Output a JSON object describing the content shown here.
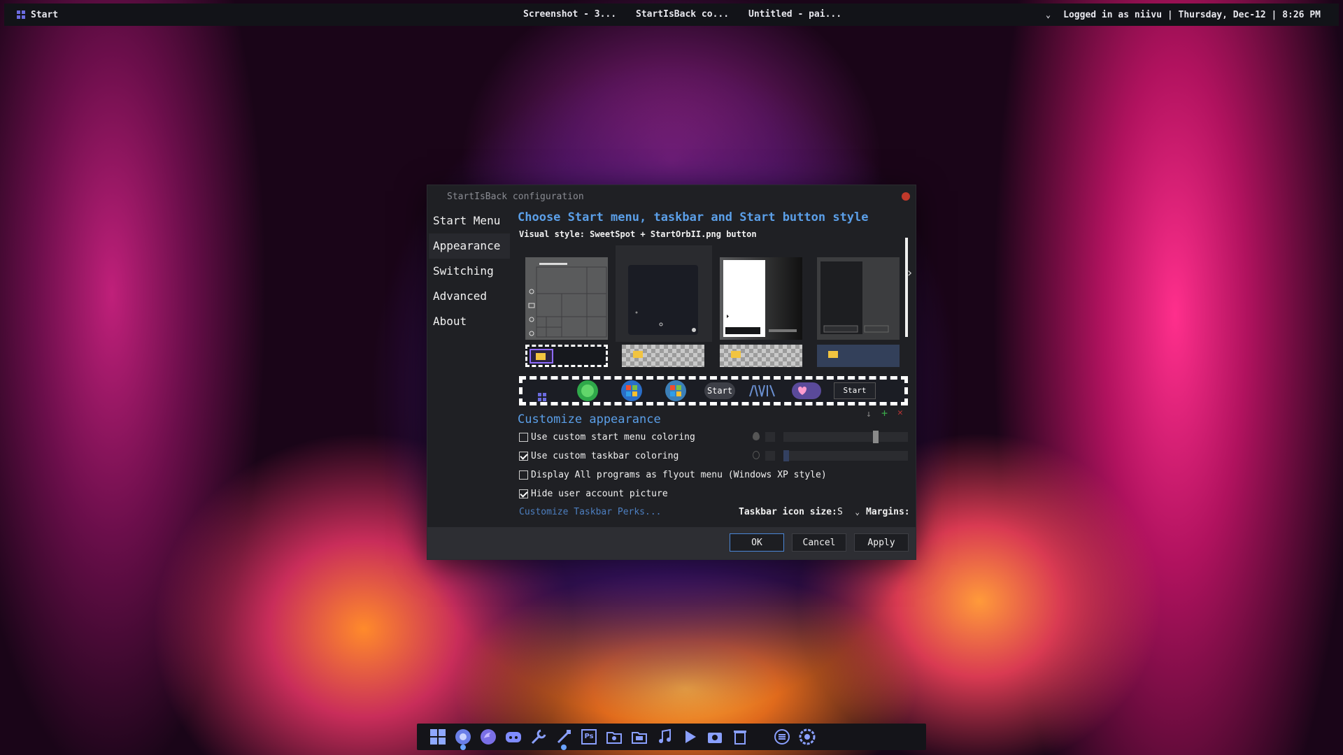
{
  "topbar": {
    "start_label": "Start",
    "tasks": [
      "Screenshot - 3...",
      "StartIsBack co...",
      "Untitled - pai..."
    ],
    "status": "Logged in as niivu | Thursday, Dec-12 | 8:26 PM"
  },
  "dialog": {
    "title": "StartIsBack configuration",
    "nav": [
      "Start Menu",
      "Appearance",
      "Switching",
      "Advanced",
      "About"
    ],
    "active_nav": "Appearance",
    "heading": "Choose Start menu, taskbar and Start button style",
    "visual_style": "Visual style: SweetSpot + StartOrbII.png button",
    "orbs": [
      "Start",
      "Start"
    ],
    "customize_heading": "Customize appearance",
    "options": [
      {
        "label": "Use custom start menu coloring",
        "checked": false
      },
      {
        "label": "Use custom taskbar coloring",
        "checked": true
      },
      {
        "label": "Display All programs as flyout menu (Windows XP style)",
        "checked": false
      },
      {
        "label": "Hide user account picture",
        "checked": true
      }
    ],
    "perks_link": "Customize Taskbar Perks...",
    "icon_size_label": "Taskbar icon size:",
    "icon_size_value": "S",
    "margins_label": "Margins:",
    "buttons": {
      "ok": "OK",
      "cancel": "Cancel",
      "apply": "Apply"
    }
  },
  "colors": {
    "accent": "#5b9fe8",
    "link": "#4d7fc0",
    "dialog_bg": "#1f2024"
  },
  "dock": {
    "icons": [
      "start-grid-icon",
      "chrome-icon",
      "firefox-icon",
      "discord-icon",
      "wrench-icon",
      "brush-icon",
      "photoshop-icon",
      "camera-folder-icon",
      "calendar-folder-icon",
      "music-icon",
      "play-icon",
      "screenshot-icon",
      "trash-icon",
      "menu-icon",
      "settings-icon"
    ],
    "photoshop_label": "Ps"
  }
}
